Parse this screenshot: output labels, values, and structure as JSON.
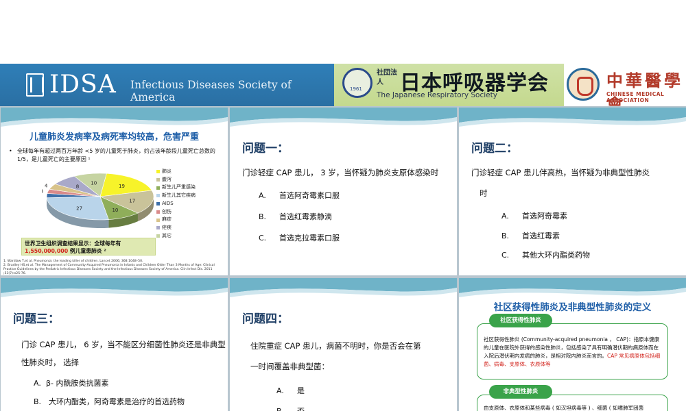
{
  "banner": {
    "idsa_logo": "IDSA",
    "idsa_name": "Infectious Diseases Society of America",
    "jrs_small": "社団法人",
    "jrs_name": "日本呼吸器学会",
    "jrs_en": "The Japanese Respiratory Society",
    "cma_cn": "中華醫學會",
    "cma_en": "CHINESE MEDICAL ASSOCIATION"
  },
  "slide1": {
    "title": "儿童肺炎发病率及病死率均较高，危害严重",
    "bullet": "全球每年有超过两百万年龄 <5 岁的儿童死于肺炎，约占该年龄段儿童死亡总数的 1/5，是儿童死亡的主要原因 ¹",
    "who_prefix": "世界卫生组织调查结果显示：全球每年有 ",
    "who_number": "1,550,000,000",
    "who_suffix": " 例儿童患肺炎 ²",
    "ref1": "1.  Wardlaw T,et al. Pneumonia: the leading killer of children. Lancet 2006; 368:1048–50.",
    "ref2": "2.  Bradley HS,et al. The Management of Community-Acquired Pneumonia in Infants and Children Older Than 3 Months of Age: Clinical Practice Guidelines by the Pediatric Infectious Diseases Society and the Infectious Diseases Society of America. Clin Infect Dis. 2011 ;53(7):e25-76."
  },
  "chart_data": {
    "type": "pie",
    "categories": [
      "肺炎",
      "腹泻",
      "新生儿严重感染",
      "新生儿其它疾病",
      "AIDS",
      "创伤",
      "麻疹",
      "疟疾",
      "其它"
    ],
    "values": [
      19,
      17,
      10,
      27,
      3,
      3,
      4,
      8,
      10
    ],
    "colors": [
      "#f7f32a",
      "#c9c39a",
      "#8fae5a",
      "#b9d4ea",
      "#3d6fa8",
      "#d98a8a",
      "#d8c38a",
      "#a9a9c9",
      "#c6d4a2"
    ],
    "legend_placement": "right"
  },
  "slide2": {
    "title": "问题一：",
    "question": "门诊轻症 CAP 患儿， 3 岁，当怀疑为肺炎支原体感染时",
    "options": [
      {
        "letter": "A.",
        "text": "首选阿奇霉素口服"
      },
      {
        "letter": "B.",
        "text": "首选红霉素静滴"
      },
      {
        "letter": "C.",
        "text": "首选克拉霉素口服"
      }
    ]
  },
  "slide3": {
    "title": "问题二：",
    "question_line1": "门诊轻症 CAP 患儿伴高热，当怀疑为非典型性肺炎",
    "question_line2": "时",
    "options": [
      {
        "letter": "A.",
        "text": "首选阿奇霉素"
      },
      {
        "letter": "B.",
        "text": "首选红霉素"
      },
      {
        "letter": "C.",
        "text": "其他大环内酯类药物"
      }
    ]
  },
  "slide4": {
    "title": "问题三：",
    "question_line1": "门诊 CAP 患儿， 6 岁，当不能区分细菌性肺炎还是非典型",
    "question_line2": "性肺炎时，  选择",
    "options": [
      {
        "letter": "A.",
        "text": "β- 内酰胺类抗菌素"
      },
      {
        "letter": "B.",
        "text": "大环内酯类，阿奇霉素是治疗的首选药物"
      }
    ]
  },
  "slide5": {
    "title": "问题四：",
    "question_line1": "住院重症 CAP 患儿，病菌不明时，你是否会在第",
    "question_line2": "一时间覆盖非典型菌：",
    "options": [
      {
        "letter": "A.",
        "text": "是"
      },
      {
        "letter": "B.",
        "text": "否"
      }
    ]
  },
  "slide6": {
    "title": "社区获得性肺炎及非典型性肺炎的定义",
    "tag1": "社区获得性肺炎",
    "def1": "社区获得性肺炎 (Community-acquired pneumonia ， CAP)：指原本健康的儿童在医院外获得的感染性肺炎，包括感染了具有明确潜伏期的病原体而在入院后潜伏期内发病的肺炎，是相对院内肺炎而言的。",
    "def1_red": "CAP 常见病原体包括细菌、病毒、支原体、衣原体等",
    "tag2": "非典型性肺炎",
    "def2": "由支原体、衣原体和某些病毒 ( 如汉坦病毒等 ) 、细菌 ( 如嗜肺军团菌"
  }
}
